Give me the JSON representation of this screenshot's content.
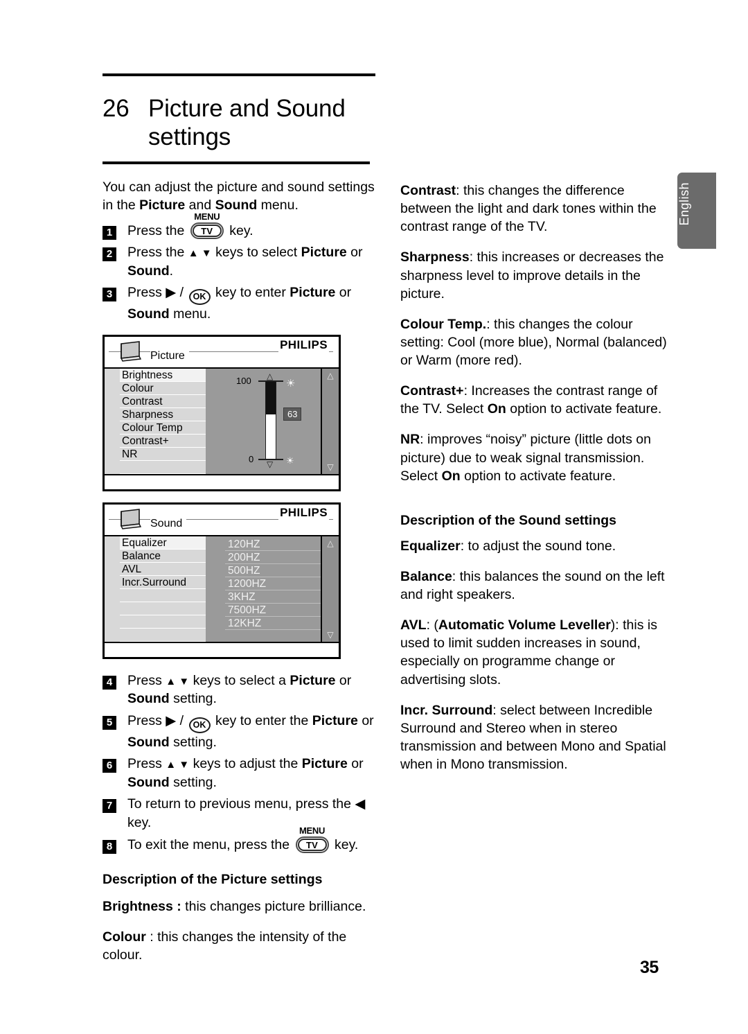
{
  "document": {
    "page_number": "35",
    "language_tab": "English"
  },
  "chapter": {
    "number": "26",
    "title_line1": "Picture and Sound",
    "title_line2": "settings"
  },
  "intro": {
    "text_a": "You can adjust the picture and sound settings in the ",
    "bold_picture": "Picture",
    "text_b": " and ",
    "bold_sound": "Sound",
    "text_c": " menu."
  },
  "steps": [
    {
      "num": "1",
      "pre": "Press the",
      "key_label": "MENU",
      "key_text": "TV",
      "post": "key."
    },
    {
      "num": "2",
      "pre": "Press the",
      "arrows": "▲ ▼",
      "mid": "keys to select ",
      "bold1": "Picture",
      "mid2": " or ",
      "bold2": "Sound",
      "post": "."
    },
    {
      "num": "3",
      "pre": "Press ▶ /",
      "key_text": "OK",
      "mid": "key to enter ",
      "bold1": "Picture",
      "mid2": " or ",
      "bold2": "Sound",
      "post": " menu."
    },
    {
      "num": "4",
      "pre": "Press",
      "arrows": "▲ ▼",
      "mid": "keys to select a ",
      "bold1": "Picture",
      "mid2": " or ",
      "bold2": "Sound",
      "post": " setting."
    },
    {
      "num": "5",
      "pre": "Press ▶ /",
      "key_text": "OK",
      "mid": "key to enter the ",
      "bold1": "Picture",
      "mid2": " or ",
      "bold2": "Sound",
      "post": " setting."
    },
    {
      "num": "6",
      "pre": "Press",
      "arrows": "▲ ▼",
      "mid": "keys to adjust the ",
      "bold1": "Picture",
      "mid2": " or ",
      "bold2": "Sound",
      "post": " setting."
    },
    {
      "num": "7",
      "pre": "To return to previous menu, press the ◀ key."
    },
    {
      "num": "8",
      "pre": "To exit the menu, press the",
      "key_label": "MENU",
      "key_text": "TV",
      "post": "key."
    }
  ],
  "osd_picture": {
    "brand": "PHILIPS",
    "title": "Picture",
    "items": [
      "Brightness",
      "Colour",
      "Contrast",
      "Sharpness",
      "Colour Temp",
      "Contrast+",
      "NR"
    ],
    "selected_item": "Brightness",
    "slider": {
      "max_label": "100",
      "min_label": "0",
      "value": "63",
      "fill_percent": 42
    },
    "scroll_up": "△",
    "scroll_down": "▽"
  },
  "osd_sound": {
    "brand": "PHILIPS",
    "title": "Sound",
    "items": [
      "Equalizer",
      "Balance",
      "AVL",
      "Incr.Surround"
    ],
    "selected_item": "Equalizer",
    "bands": [
      "120HZ",
      "200HZ",
      "500HZ",
      "1200HZ",
      "3KHZ",
      "7500HZ",
      "12KHZ"
    ],
    "scroll_up": "△",
    "scroll_down": "▽"
  },
  "picture_settings": {
    "heading": "Description of the Picture settings",
    "entries": [
      {
        "term": "Brightness :",
        "desc": " this changes picture brilliance."
      },
      {
        "term": "Colour",
        "desc": " : this changes the intensity of the colour."
      }
    ]
  },
  "right_column": {
    "picture_entries": [
      {
        "term": "Contrast",
        "desc": ": this changes the difference between the light and dark tones within the contrast range of the TV."
      },
      {
        "term": "Sharpness",
        "desc": ": this increases or decreases the sharpness level to improve details in the picture."
      },
      {
        "term": "Colour Temp.",
        "desc": ": this changes the colour setting: Cool (more blue), Normal (balanced) or Warm (more red)."
      },
      {
        "term": "Contrast+",
        "desc_a": ": Increases the contrast range of the TV. Select ",
        "bold_on": "On",
        "desc_b": " option to activate feature."
      },
      {
        "term": "NR",
        "desc_a": ": improves “noisy” picture (little dots on picture) due to weak signal transmission. Select ",
        "bold_on": "On",
        "desc_b": " option to activate feature."
      }
    ],
    "sound_heading": "Description of the Sound settings",
    "sound_entries": [
      {
        "term": "Equalizer",
        "desc": ": to adjust the sound tone."
      },
      {
        "term": "Balance",
        "desc": ": this balances the sound on the left and right speakers."
      },
      {
        "term": "AVL",
        "desc_a": ": (",
        "bold_mid": "Automatic  Volume Leveller",
        "desc_b": "): this is used to limit sudden  increases in sound, especially on programme change or advertising slots."
      },
      {
        "term": "Incr. Surround",
        "desc": ": select between Incredible Surround  and Stereo when in stereo transmission and between Mono and Spatial when in Mono transmission."
      }
    ]
  }
}
